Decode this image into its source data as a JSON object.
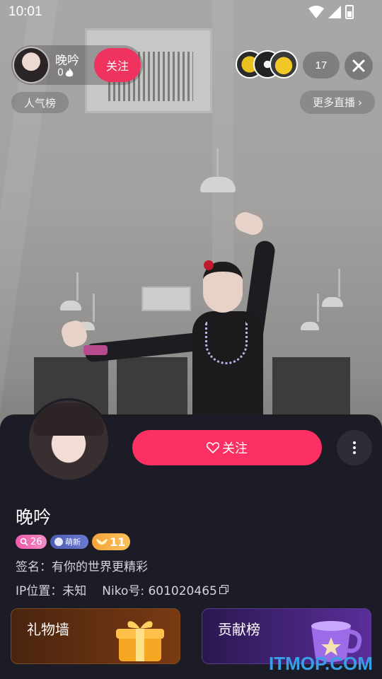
{
  "status_bar": {
    "time": "10:01"
  },
  "host": {
    "name": "晚吟",
    "heat": "0",
    "follow_label": "关注"
  },
  "viewers": {
    "count": "17"
  },
  "tags": {
    "popularity": "人气榜",
    "more_live": "更多直播",
    "more_live_chevron": "›"
  },
  "profile": {
    "name": "晚吟",
    "follow_label": "关注",
    "badges": {
      "level": "26",
      "fan_tag": "萌新",
      "wing_level": "11"
    },
    "signature": "签名：有你的世界更精彩",
    "ip": "IP位置：未知",
    "niko_id": "Niko号: 601020465"
  },
  "cards": {
    "gift_wall": "礼物墙",
    "contribution": "贡献榜"
  },
  "watermark": "ITMOP.COM",
  "colors": {
    "accent": "#fc3062",
    "sheet_bg": "#1b1c26"
  }
}
